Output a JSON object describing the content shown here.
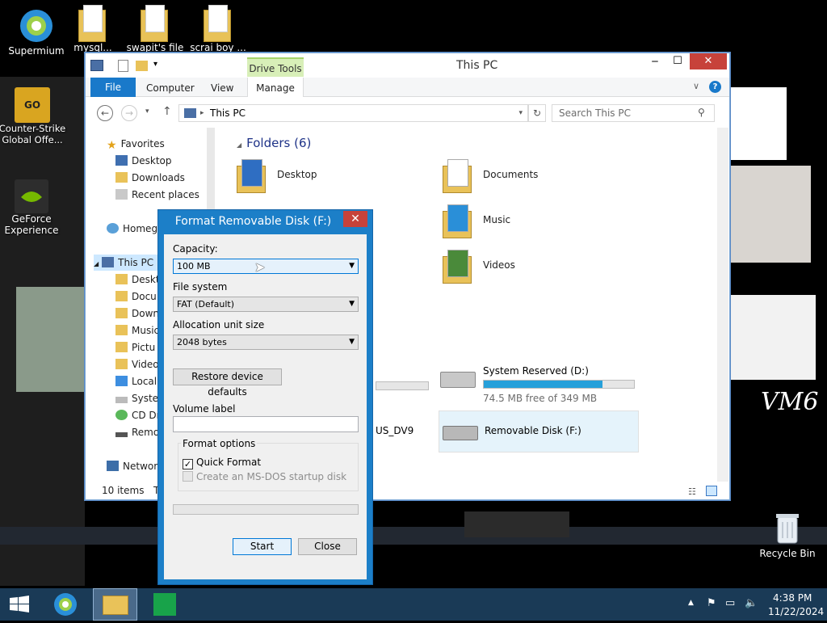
{
  "desktop": {
    "icons": [
      {
        "label": "Supermium"
      },
      {
        "label": "mysql..."
      },
      {
        "label": "swapit's file"
      },
      {
        "label": "scrai boy ..."
      },
      {
        "label": "Counter-Strike Global Offe..."
      },
      {
        "label": "GeForce Experience"
      },
      {
        "label": "Recycle Bin"
      }
    ],
    "annotation_text": "VM6"
  },
  "explorer": {
    "title": "This PC",
    "drive_tools_label": "Drive Tools",
    "tabs": {
      "file": "File",
      "computer": "Computer",
      "view": "View",
      "manage": "Manage"
    },
    "address": "This PC",
    "search_placeholder": "Search This PC",
    "nav": {
      "favorites": "Favorites",
      "desktop": "Desktop",
      "downloads": "Downloads",
      "recent": "Recent places",
      "homegroup": "Homegr",
      "thispc": "This PC",
      "sub": [
        "Deskto",
        "Docu",
        "Down",
        "Music",
        "Pictu",
        "Video",
        "Local",
        "Syster",
        "CD Dr",
        "Remo"
      ],
      "network": "Network"
    },
    "folders_header": "Folders (6)",
    "folders": {
      "desktop": "Desktop",
      "documents": "Documents",
      "music": "Music",
      "videos": "Videos"
    },
    "devices": {
      "sysres_name": "System Reserved (D:)",
      "sysres_free": "74.5 MB free of 349 MB",
      "sysres_fill": 0.79,
      "cd_partial": "US_DV9",
      "removable_name": "Removable Disk (F:)"
    },
    "status": "10 items",
    "status_tail": "T"
  },
  "dialog": {
    "title": "Format Removable Disk (F:)",
    "capacity_label": "Capacity:",
    "capacity_value": "100 MB",
    "fs_label": "File system",
    "fs_value": "FAT (Default)",
    "alloc_label": "Allocation unit size",
    "alloc_value": "2048 bytes",
    "restore_btn": "Restore device defaults",
    "volume_label": "Volume label",
    "volume_value": "",
    "format_options": "Format options",
    "quick_format": "Quick Format",
    "msdos": "Create an MS-DOS startup disk",
    "start_btn": "Start",
    "close_btn": "Close"
  },
  "taskbar": {
    "time": "4:38 PM",
    "date": "11/22/2024"
  },
  "colors": {
    "dialog_frame": "#1c7fc8",
    "file_tab": "#1979ca",
    "taskbar": "#1a3a56",
    "close_red": "#c7423a"
  }
}
